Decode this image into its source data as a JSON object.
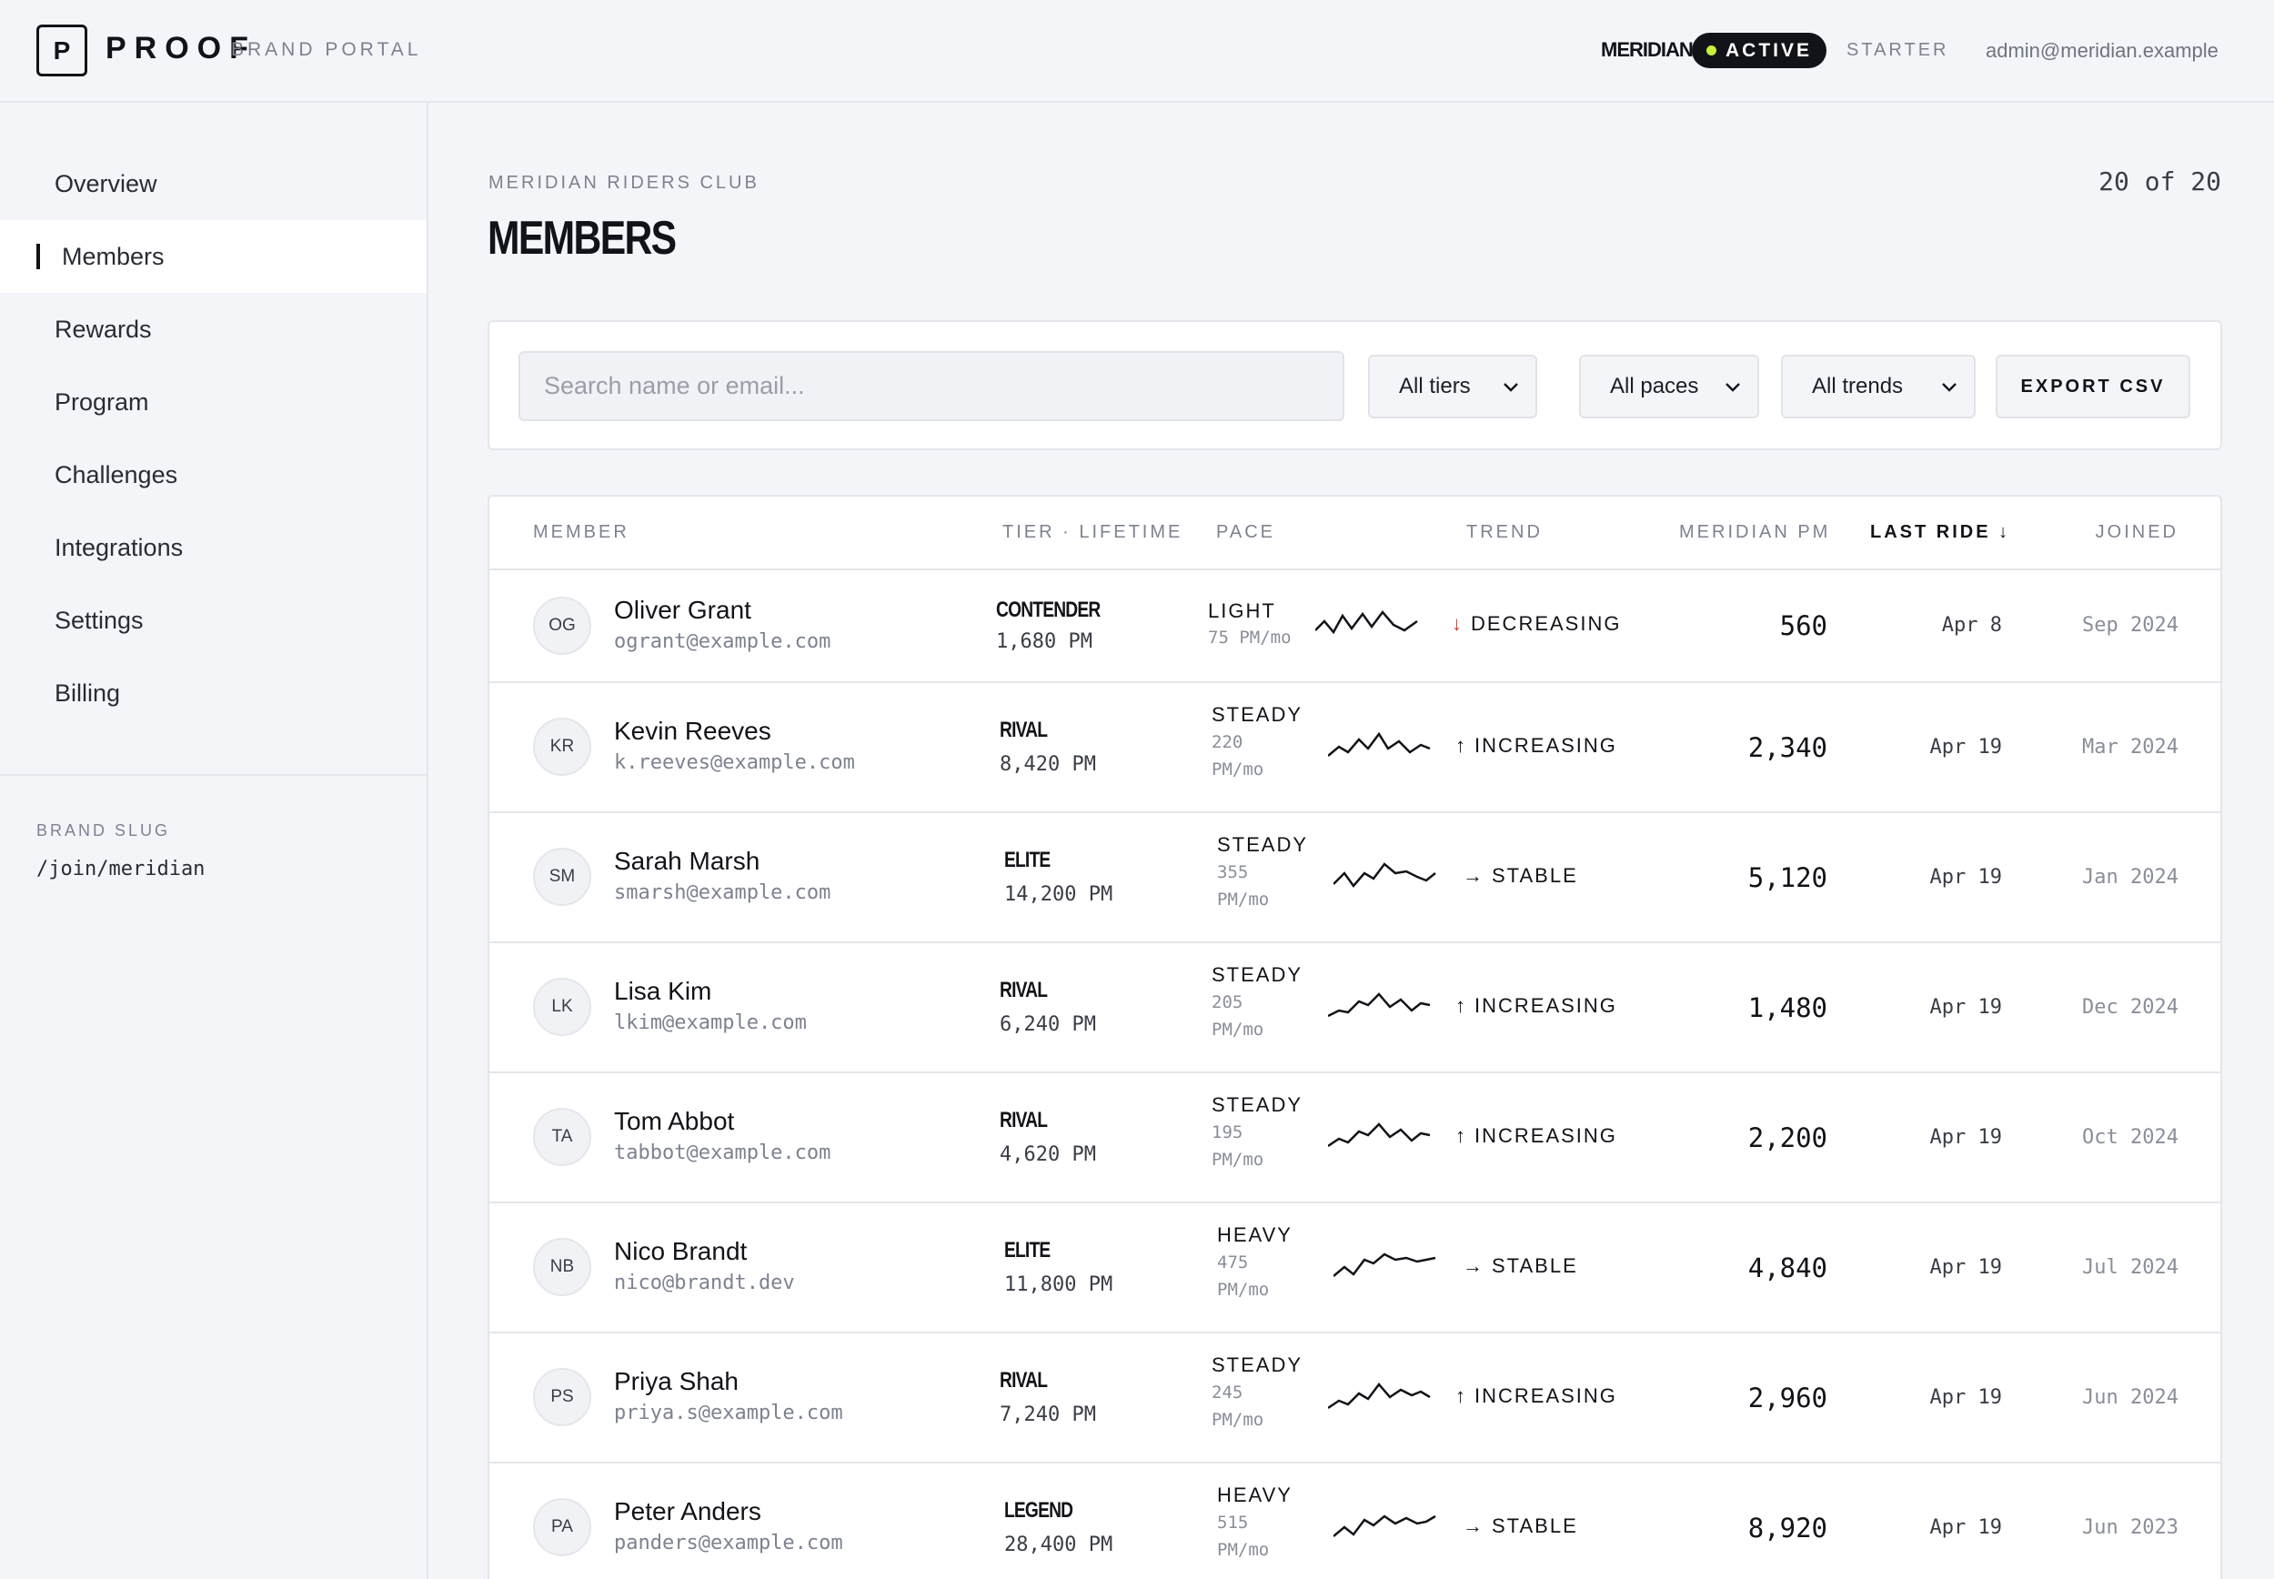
{
  "header": {
    "logo_letter": "P",
    "brand": "PROOF",
    "portal_label": "BRAND PORTAL",
    "org_name": "MERIDIAN",
    "status": "ACTIVE",
    "plan": "STARTER",
    "user_email": "admin@meridian.example",
    "status_dot_color": "#c6f03a"
  },
  "sidebar": {
    "items": [
      {
        "label": "Overview",
        "icon": null
      },
      {
        "label": "Members",
        "active": true
      },
      {
        "label": "Rewards"
      },
      {
        "label": "Program"
      },
      {
        "label": "Challenges"
      },
      {
        "label": "Integrations"
      },
      {
        "label": "Settings"
      },
      {
        "label": "Billing"
      }
    ],
    "slug_label": "BRAND SLUG",
    "slug_value": "/join/meridian"
  },
  "page": {
    "breadcrumb": "MERIDIAN RIDERS CLUB",
    "title": "MEMBERS",
    "count": "20 of 20"
  },
  "filters": {
    "search_placeholder": "Search name or email...",
    "tier": "All tiers",
    "pace": "All paces",
    "trend": "All trends",
    "export_label": "EXPORT CSV"
  },
  "table": {
    "headers": {
      "member": "MEMBER",
      "tier": "TIER · LIFETIME",
      "pace": "PACE",
      "trend": "TREND",
      "pm": "MERIDIAN PM",
      "last": "LAST RIDE ↓",
      "joined": "JOINED"
    },
    "rows": [
      {
        "initials": "OG",
        "name": "Oliver Grant",
        "email": "ogrant@example.com",
        "tier": "CONTENDER",
        "lifetime": "1,680 PM",
        "pace": "LIGHT",
        "rate": "75 PM/mo",
        "trend_arrow": "↓",
        "trend": "DECREASING",
        "pm": "560",
        "last": "Apr 8",
        "joined": "Sep 2024"
      },
      {
        "initials": "KR",
        "name": "Kevin Reeves",
        "email": "k.reeves@example.com",
        "tier": "RIVAL",
        "lifetime": "8,420 PM",
        "pace": "STEADY",
        "rate1": "220",
        "rate2": "PM/mo",
        "trend_arrow": "↑",
        "trend": "INCREASING",
        "pm": "2,340",
        "last": "Apr 19",
        "joined": "Mar 2024"
      },
      {
        "initials": "SM",
        "name": "Sarah Marsh",
        "email": "smarsh@example.com",
        "tier": "ELITE",
        "lifetime": "14,200 PM",
        "pace": "STEADY",
        "rate1": "355",
        "rate2": "PM/mo",
        "trend_arrow": "→",
        "trend": "STABLE",
        "pm": "5,120",
        "last": "Apr 19",
        "joined": "Jan 2024"
      },
      {
        "initials": "LK",
        "name": "Lisa Kim",
        "email": "lkim@example.com",
        "tier": "RIVAL",
        "lifetime": "6,240 PM",
        "pace": "STEADY",
        "rate1": "205",
        "rate2": "PM/mo",
        "trend_arrow": "↑",
        "trend": "INCREASING",
        "pm": "1,480",
        "last": "Apr 19",
        "joined": "Dec 2024"
      },
      {
        "initials": "TA",
        "name": "Tom Abbot",
        "email": "tabbot@example.com",
        "tier": "RIVAL",
        "lifetime": "4,620 PM",
        "pace": "STEADY",
        "rate1": "195",
        "rate2": "PM/mo",
        "trend_arrow": "↑",
        "trend": "INCREASING",
        "pm": "2,200",
        "last": "Apr 19",
        "joined": "Oct 2024"
      },
      {
        "initials": "NB",
        "name": "Nico Brandt",
        "email": "nico@brandt.dev",
        "tier": "ELITE",
        "lifetime": "11,800 PM",
        "pace": "HEAVY",
        "rate1": "475",
        "rate2": "PM/mo",
        "trend_arrow": "→",
        "trend": "STABLE",
        "pm": "4,840",
        "last": "Apr 19",
        "joined": "Jul 2024"
      },
      {
        "initials": "PS",
        "name": "Priya Shah",
        "email": "priya.s@example.com",
        "tier": "RIVAL",
        "lifetime": "7,240 PM",
        "pace": "STEADY",
        "rate1": "245",
        "rate2": "PM/mo",
        "trend_arrow": "↑",
        "trend": "INCREASING",
        "pm": "2,960",
        "last": "Apr 19",
        "joined": "Jun 2024"
      },
      {
        "initials": "PA",
        "name": "Peter Anders",
        "email": "panders@example.com",
        "tier": "LEGEND",
        "lifetime": "28,400 PM",
        "pace": "HEAVY",
        "rate1": "515",
        "rate2": "PM/mo",
        "trend_arrow": "→",
        "trend": "STABLE",
        "pm": "8,920",
        "last": "Apr 19",
        "joined": "Jun 2023"
      }
    ]
  }
}
